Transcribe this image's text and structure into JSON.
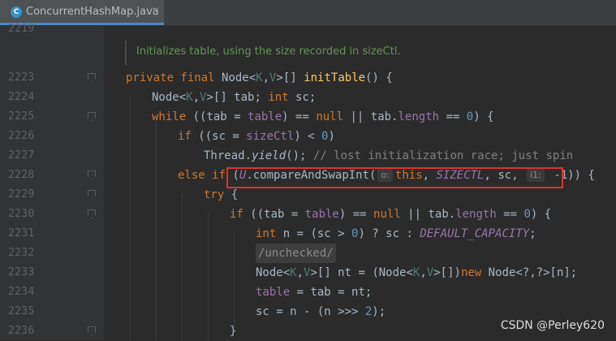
{
  "editor": {
    "tab": {
      "icon": "C",
      "filename": "ConcurrentHashMap.java",
      "close": "×"
    },
    "doc_comment": "Initializes table, using the size recorded in sizeCtl.",
    "line_numbers": {
      "l2219": "2219",
      "l2223": "2223",
      "l2224": "2224",
      "l2225": "2225",
      "l2226": "2226",
      "l2227": "2227",
      "l2228": "2228",
      "l2229": "2229",
      "l2230": "2230",
      "l2231": "2231",
      "l2232": "2232",
      "l2233": "2233",
      "l2234": "2234",
      "l2235": "2235",
      "l2236": "2236"
    },
    "code": {
      "l2223": {
        "kw": "private final ",
        "type": "Node<",
        "k": "K",
        "comma": ",",
        "v": "V",
        "close": ">[] ",
        "method": "initTable",
        "rest": "() {"
      },
      "l2224": {
        "type": "Node<",
        "k": "K",
        "comma": ",",
        "v": "V",
        "mid": ">[] tab; ",
        "kw": "int",
        "rest": " sc;"
      },
      "l2225": {
        "kw": "while",
        "p1": " ((tab = ",
        "f1": "table",
        "p2": ") == ",
        "kwnull": "null",
        "p3": " || tab.",
        "f2": "length",
        "p4": " == ",
        "n": "0",
        "p5": ") {"
      },
      "l2226": {
        "kw": "if",
        "p1": " ((sc = ",
        "f1": "sizeCtl",
        "p2": ") < ",
        "n": "0",
        "p3": ")"
      },
      "l2227": {
        "p1": "Thread.",
        "m": "yield",
        "p2": "(); ",
        "cmt": "// lost initialization race; just spin"
      },
      "l2228": {
        "kw": "else if",
        "p1": " (",
        "u": "U",
        "p2": ".compareAndSwapInt(",
        "hint1": "o:",
        "p3": "this",
        "p4": ", ",
        "c": "SIZECTL",
        "p5": ", sc, ",
        "hint2": "i1:",
        "p6": " -1)) {"
      },
      "l2229": {
        "kw": "try",
        "p1": " {"
      },
      "l2230": {
        "kw": "if",
        "p1": " ((tab = ",
        "f1": "table",
        "p2": ") == ",
        "kwnull": "null",
        "p3": " || tab.",
        "f2": "length",
        "p4": " == ",
        "n": "0",
        "p5": ") {"
      },
      "l2231": {
        "kw": "int",
        "p1": " n = (sc > ",
        "n": "0",
        "p2": ") ? sc : ",
        "c": "DEFAULT_CAPACITY",
        "p3": ";"
      },
      "l2232": {
        "tag": "/unchecked/"
      },
      "l2233": {
        "type": "Node<",
        "k": "K",
        "comma": ",",
        "v": "V",
        "p1": ">[] nt = (Node<",
        "k2": "K",
        "comma2": ",",
        "v2": "V",
        "p2": ">[])",
        "kwnew": "new",
        "p3": " Node<?,?>[n];"
      },
      "l2234": {
        "f1": "table",
        "p1": " = tab = nt;"
      },
      "l2235": {
        "p1": "sc = n - (n >>> ",
        "n": "2",
        "p2": ");"
      },
      "l2236": {
        "p1": "}"
      }
    },
    "watermark": "CSDN @Perley620",
    "colors": {
      "background": "#2b2b2b",
      "keyword": "#cc7832",
      "field": "#9876aa",
      "number": "#6897bb",
      "method": "#ffc66d",
      "comment": "#808080",
      "doc": "#629755",
      "highlight_box": "#e03131"
    }
  }
}
